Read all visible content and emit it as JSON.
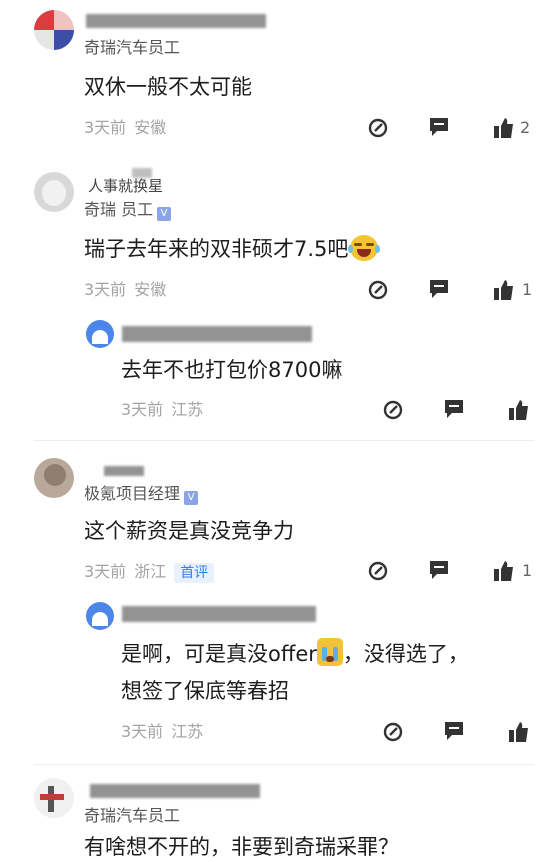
{
  "comments": [
    {
      "role": "奇瑞汽车员工",
      "text": "双休一般不太可能",
      "time": "3天前",
      "location": "安徽",
      "likes": "2"
    },
    {
      "username_visible": "人事就换星",
      "role": "奇瑞 员工",
      "verified_mark": "V",
      "text": "瑞子去年来的双非硕才7.5吧",
      "emoji": "laughing-crying-emoji",
      "time": "3天前",
      "location": "安徽",
      "likes": "1",
      "reply": {
        "text": "去年不也打包价8700嘛",
        "time": "3天前",
        "location": "江苏"
      }
    },
    {
      "role": "极氪项目经理",
      "verified_mark": "V",
      "text": "这个薪资是真没竞争力",
      "time": "3天前",
      "location": "浙江",
      "tag": "首评",
      "likes": "1",
      "reply": {
        "text_line1": "是啊，可是真没offer",
        "text_line1_tail": "，没得选了，",
        "text_line2": "想签了保底等春招",
        "emoji": "crying-emoji",
        "time": "3天前",
        "location": "江苏"
      }
    },
    {
      "role": "奇瑞汽车员工",
      "text": "有啥想不开的，非要到奇瑞采罪？"
    }
  ],
  "colors": {
    "meta_gray": "#a4a4a4",
    "tag_blue": "#3b7cf6",
    "verify_blue": "#8aa4e6"
  }
}
